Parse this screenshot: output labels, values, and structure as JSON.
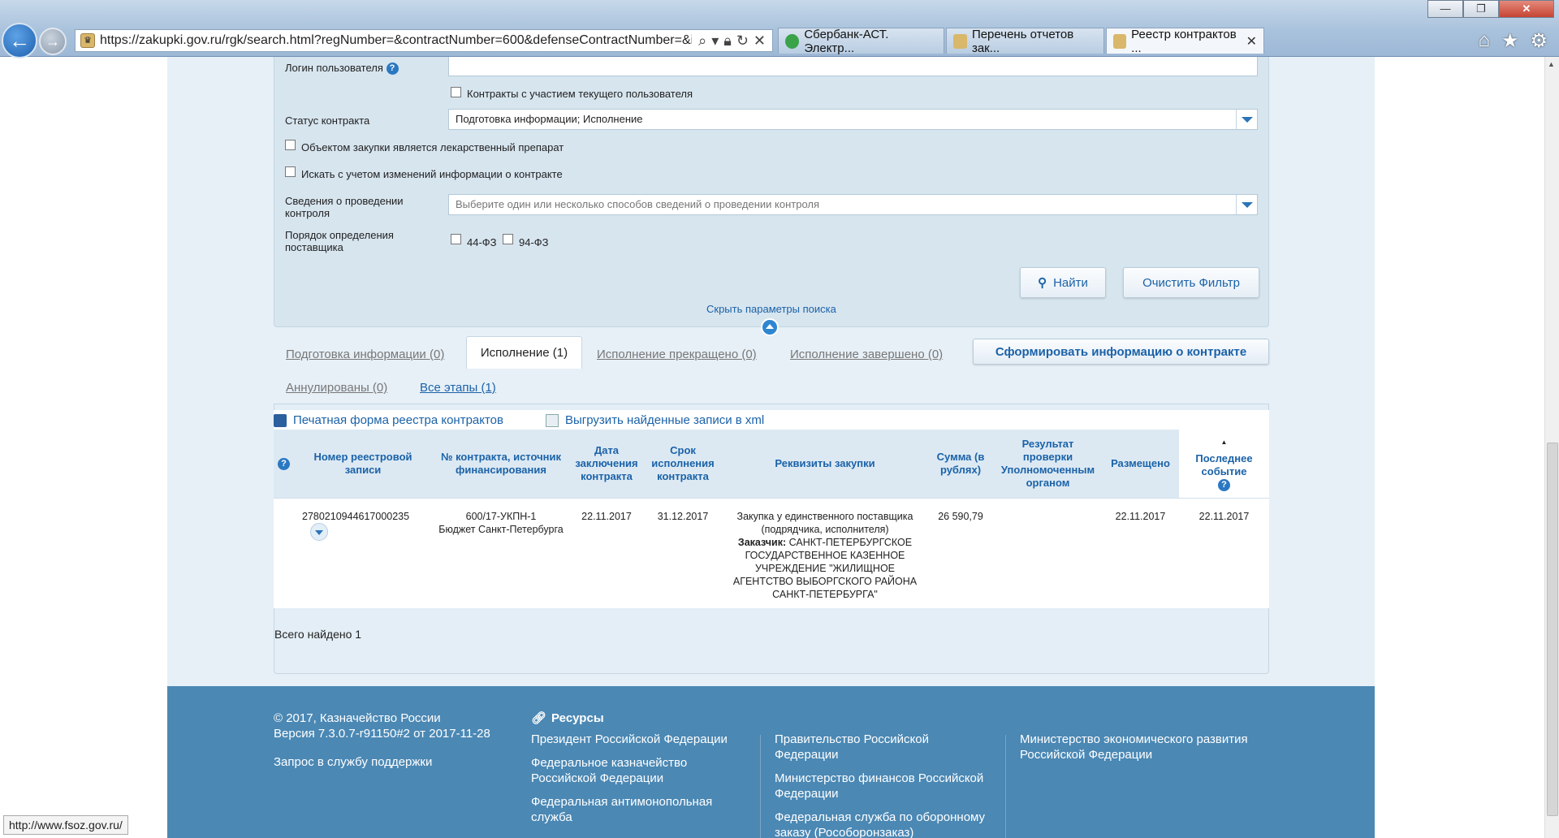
{
  "browser": {
    "url": "https://zakupki.gov.ru/rgk/search.html?regNumber=&contractNumber=600&defenseContractNumber=&ik",
    "tabs": [
      {
        "label": "Сбербанк-АСТ. Электр..."
      },
      {
        "label": "Перечень отчетов зак..."
      },
      {
        "label": "Реестр контрактов ..."
      }
    ],
    "status_url": "http://www.fsoz.gov.ru/"
  },
  "filter": {
    "login_label": "Логин пользователя",
    "login_value": "",
    "current_user_label": "Контракты с участием текущего пользователя",
    "status_label": "Статус контракта",
    "status_value": "Подготовка информации; Исполнение",
    "drug_label": "Объектом закупки является лекарственный препарат",
    "changes_label": "Искать с учетом изменений информации о контракте",
    "control_label": "Сведения о проведении контроля",
    "control_placeholder": "Выберите один или несколько способов сведений о проведении контроля",
    "procedure_label": "Порядок определения поставщика",
    "fz44": "44-ФЗ",
    "fz94": "94-ФЗ",
    "find_button": "Найти",
    "clear_button": "Очистить Фильтр",
    "hide_link": "Скрыть параметры поиска"
  },
  "stage_tabs": {
    "prep": "Подготовка информации (0)",
    "exec": "Исполнение (1)",
    "terminated": "Исполнение прекращено (0)",
    "completed": "Исполнение завершено (0)",
    "cancelled": "Аннулированы (0)",
    "all": "Все этапы (1)",
    "form_button": "Сформировать информацию о контракте"
  },
  "tools": {
    "print": "Печатная форма реестра контрактов",
    "export": "Выгрузить найденные записи в xml"
  },
  "table": {
    "headers": {
      "reg_number": "Номер реестровой записи",
      "contract_number": "№ контракта, источник финансирования",
      "date_concluded": "Дата заключения контракта",
      "due_date": "Срок исполнения контракта",
      "requisites": "Реквизиты закупки",
      "sum": "Сумма (в рублях)",
      "check_result": "Результат проверки Уполномоченным органом",
      "posted": "Размещено",
      "last_event": "Последнее событие"
    },
    "rows": [
      {
        "reg_number": "2780210944617000235",
        "contract_number": "600/17-УКПН-1",
        "source": "Бюджет Санкт-Петербурга",
        "date_concluded": "22.11.2017",
        "due_date": "31.12.2017",
        "method": "Закупка у единственного поставщика (подрядчика, исполнителя)",
        "customer_label": "Заказчик:",
        "customer": "САНКТ-ПЕТЕРБУРГСКОЕ ГОСУДАРСТВЕННОЕ КАЗЕННОЕ УЧРЕЖДЕНИЕ \"ЖИЛИЩНОЕ АГЕНТСТВО ВЫБОРГСКОГО РАЙОНА САНКТ-ПЕТЕРБУРГА\"",
        "sum": "26 590,79",
        "check_result": "",
        "posted": "22.11.2017",
        "last_event": "22.11.2017"
      }
    ],
    "total": "Всего найдено 1"
  },
  "footer": {
    "copyright": "© 2017, Казначейство России",
    "version": "Версия 7.3.0.7-r91150#2 от 2017-11-28",
    "support": "Запрос в службу поддержки",
    "resources_title": "Ресурсы",
    "col1": [
      "Президент Российской Федерации",
      "Федеральное казначейство Российской Федерации",
      "Федеральная антимонопольная служба"
    ],
    "col2": [
      "Правительство Российской Федерации",
      "Министерство финансов Российской Федерации",
      "Федеральная служба по оборонному заказу (Рособоронзаказ)"
    ],
    "col3": [
      "Министерство экономического развития Российской Федерации"
    ]
  },
  "colors": {
    "accent": "#1b62a8",
    "footer": "#4b88b4",
    "filter_bg": "#d7e5ef"
  },
  "icons": [
    "back-icon",
    "forward-icon",
    "search-icon",
    "lock-icon",
    "refresh-icon",
    "close-icon",
    "home-icon",
    "star-icon",
    "gear-icon",
    "help-icon",
    "save-icon",
    "export-icon",
    "chevron-down-icon",
    "chevron-up-icon",
    "link-icon"
  ]
}
